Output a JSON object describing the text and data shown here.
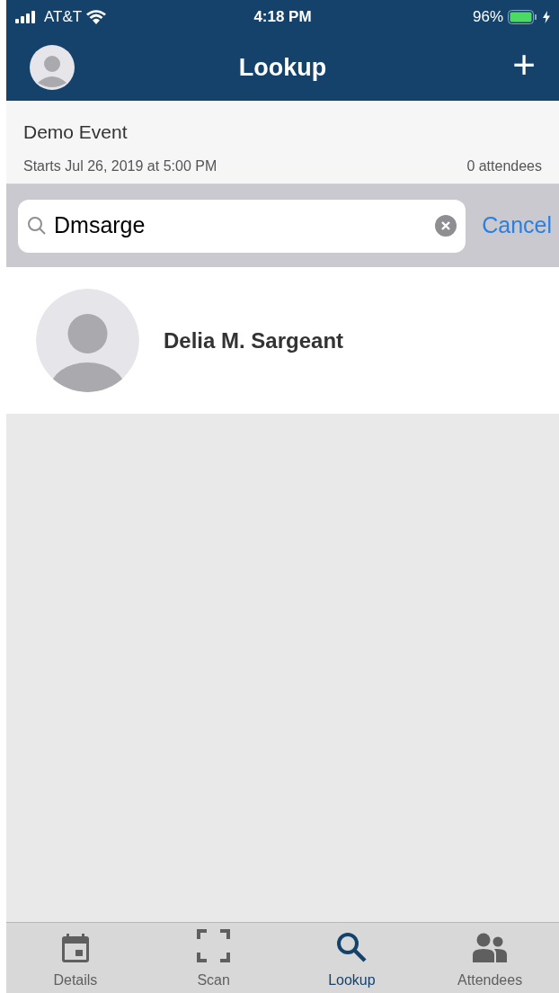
{
  "status_bar": {
    "carrier": "AT&T",
    "time": "4:18 PM",
    "battery": "96%"
  },
  "nav": {
    "title": "Lookup",
    "action": "+"
  },
  "event": {
    "name": "Demo Event",
    "starts": "Starts Jul 26, 2019 at 5:00 PM",
    "attendees": "0 attendees"
  },
  "search": {
    "value": "Dmsarge",
    "cancel": "Cancel"
  },
  "results": [
    {
      "name": "Delia M. Sargeant"
    }
  ],
  "tabs": [
    {
      "label": "Details",
      "kind": "calendar",
      "selected": false
    },
    {
      "label": "Scan",
      "kind": "scan",
      "selected": false
    },
    {
      "label": "Lookup",
      "kind": "search",
      "selected": true
    },
    {
      "label": "Attendees",
      "kind": "people",
      "selected": false
    }
  ]
}
